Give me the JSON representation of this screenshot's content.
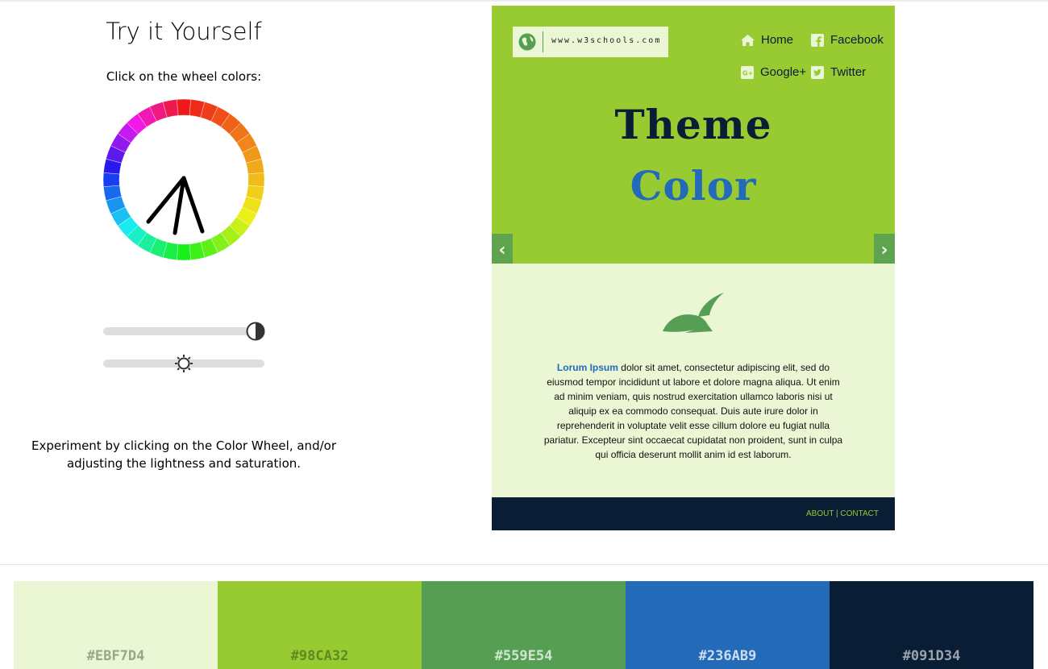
{
  "left": {
    "heading": "Try it Yourself",
    "instruction": "Click on the wheel colors:",
    "experiment": "Experiment by clicking on the Color Wheel, and/or adjusting the lightness and saturation.",
    "lightness_slider": {
      "value": 1.0,
      "icon": "contrast-icon"
    },
    "saturation_slider": {
      "value": 0.5,
      "icon": "sun-icon"
    }
  },
  "preview": {
    "logo_text": "www.w3schools.com",
    "nav": [
      {
        "label": "Home",
        "icon": "home-icon"
      },
      {
        "label": "Facebook",
        "icon": "facebook-icon"
      },
      {
        "label": "Google+",
        "icon": "google-plus-icon"
      },
      {
        "label": "Twitter",
        "icon": "twitter-icon"
      }
    ],
    "title_line1": "Theme",
    "title_line2": "Color",
    "prev_arrow": "‹",
    "next_arrow": "›",
    "lorem_highlight": "Lorum Ipsum",
    "lorem_text": "dolor sit amet, consectetur adipiscing elit, sed do eiusmod tempor incididunt ut labore et dolore magna aliqua. Ut enim ad minim veniam, quis nostrud exercitation ullamco laboris nisi ut aliquip ex ea commodo consequat. Duis aute irure dolor in reprehenderit in voluptate velit esse cillum dolore eu fugiat nulla pariatur. Excepteur sint occaecat cupidatat non proident, sunt in culpa qui officia deserunt mollit anim id est laborum.",
    "footer_links": "ABOUT | CONTACT"
  },
  "swatches": [
    {
      "hex": "#EBF7D4",
      "text_color": "#9aa58a"
    },
    {
      "hex": "#98CA32",
      "text_color": "#5f8a1f"
    },
    {
      "hex": "#559E54",
      "text_color": "#cfe6cf"
    },
    {
      "hex": "#236AB9",
      "text_color": "#cddcf0"
    },
    {
      "hex": "#091D34",
      "text_color": "#9aa3ad"
    }
  ],
  "colors": {
    "light": "#EBF7D4",
    "main": "#98CA32",
    "mid": "#559E54",
    "accent": "#236AB9",
    "dark": "#091D34"
  }
}
